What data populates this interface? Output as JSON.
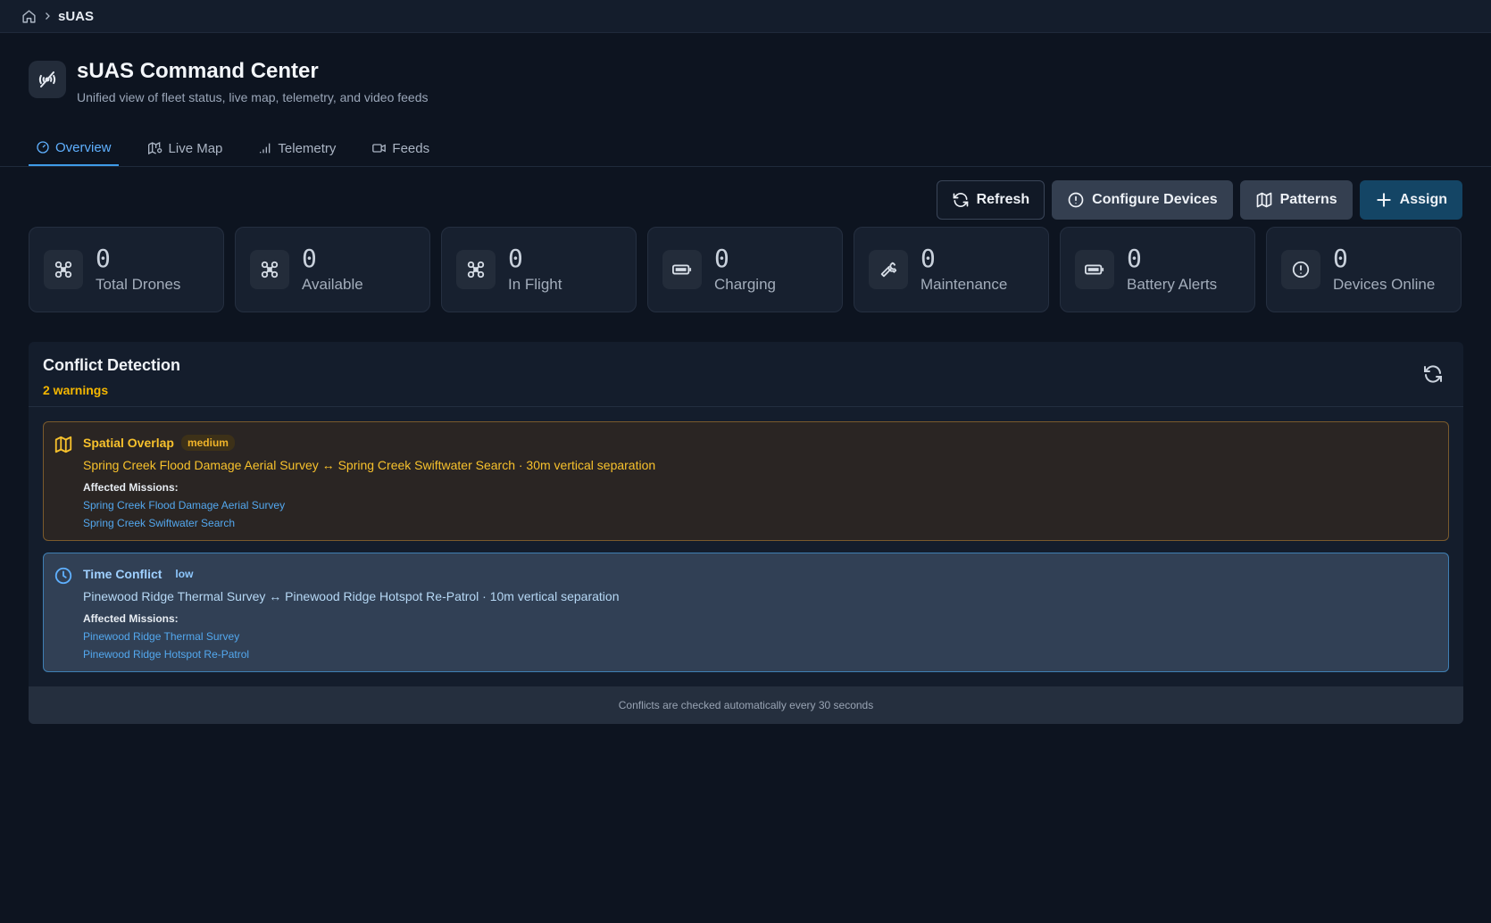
{
  "breadcrumb": {
    "current": "sUAS"
  },
  "header": {
    "title": "sUAS Command Center",
    "subtitle": "Unified view of fleet status, live map, telemetry, and video feeds"
  },
  "tabs": [
    {
      "label": "Overview",
      "icon": "gauge-icon",
      "active": true
    },
    {
      "label": "Live Map",
      "icon": "map-pin-icon",
      "active": false
    },
    {
      "label": "Telemetry",
      "icon": "signal-bars-icon",
      "active": false
    },
    {
      "label": "Feeds",
      "icon": "video-icon",
      "active": false
    }
  ],
  "actions": {
    "refresh": "Refresh",
    "configure": "Configure Devices",
    "patterns": "Patterns",
    "assign": "Assign"
  },
  "stats": [
    {
      "value": "0",
      "label": "Total Drones",
      "icon": "drone-icon"
    },
    {
      "value": "0",
      "label": "Available",
      "icon": "drone-icon"
    },
    {
      "value": "0",
      "label": "In Flight",
      "icon": "drone-icon"
    },
    {
      "value": "0",
      "label": "Charging",
      "icon": "battery-icon"
    },
    {
      "value": "0",
      "label": "Maintenance",
      "icon": "wrench-icon"
    },
    {
      "value": "0",
      "label": "Battery Alerts",
      "icon": "battery-icon"
    },
    {
      "value": "0",
      "label": "Devices Online",
      "icon": "alert-circle-icon"
    }
  ],
  "conflicts": {
    "title": "Conflict Detection",
    "warnings": "2 warnings",
    "items": [
      {
        "type": "Spatial Overlap",
        "severity": "medium",
        "description": "Spring Creek Flood Damage Aerial Survey ↔ Spring Creek Swiftwater Search · 30m vertical separation",
        "affected_label": "Affected Missions:",
        "missions": [
          "Spring Creek Flood Damage Aerial Survey",
          "Spring Creek Swiftwater Search"
        ]
      },
      {
        "type": "Time Conflict",
        "severity": "low",
        "description": "Pinewood Ridge Thermal Survey ↔ Pinewood Ridge Hotspot Re-Patrol · 10m vertical separation",
        "affected_label": "Affected Missions:",
        "missions": [
          "Pinewood Ridge Thermal Survey",
          "Pinewood Ridge Hotspot Re-Patrol"
        ]
      }
    ],
    "footer": "Conflicts are checked automatically every 30 seconds"
  },
  "colors": {
    "accent": "#3f9be8",
    "warning": "#f5b700",
    "background": "#0d1420",
    "primary_button": "#144565"
  }
}
